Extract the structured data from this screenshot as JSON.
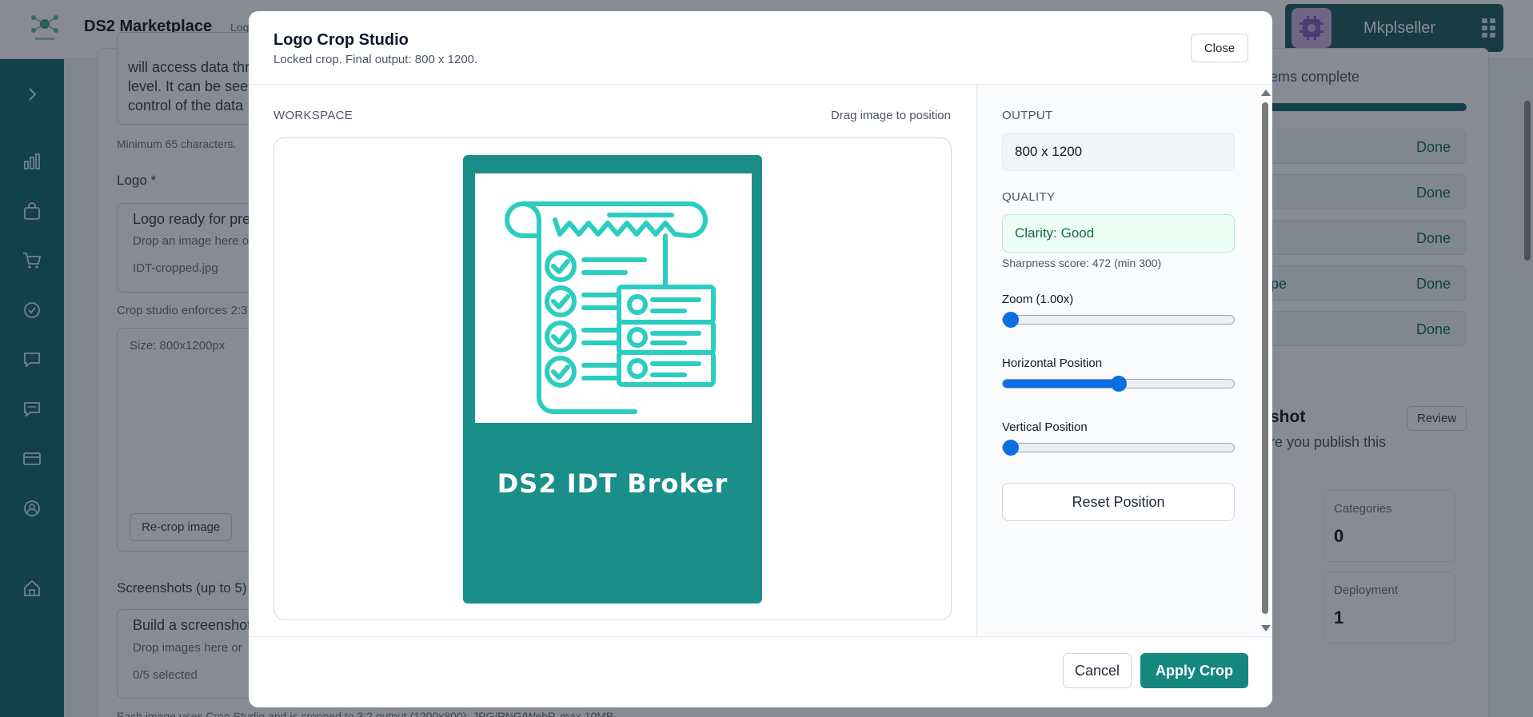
{
  "app": {
    "brand": "DS2 Marketplace",
    "brand_sub": "Log",
    "user_name": "Mkplseller"
  },
  "background": {
    "desc_line1": "will access data thr",
    "desc_line2": "level. It can be see",
    "desc_line3": "control of the data",
    "min_chars": "Minimum 65 characters.",
    "logo_label": "Logo *",
    "logo_ready": "Logo ready for pre",
    "logo_drop": "Drop an image here o",
    "logo_file": "IDT-cropped.jpg",
    "crop_note": "Crop studio enforces 2:3",
    "size_note": "Size: 800x1200px",
    "recrop_button": "Re-crop image",
    "screenshots_label": "Screenshots (up to 5)",
    "screenshot_build": "Build a screenshot",
    "screenshot_drop": "Drop images here or",
    "screenshot_selected": "0/5 selected",
    "footer_note": "Each image uses Crop Studio and is cropped to 3:2 output (1200x800). JPG/PNG/WebP, max 10MB.",
    "items_complete": "ems complete",
    "done_label": "Done",
    "done_row_4_prefix": "pe",
    "snapshot_title": "shot",
    "snapshot_sub": "re you publish this",
    "review_button": "Review",
    "stats": [
      {
        "label": "Categories",
        "value": "0"
      },
      {
        "label": "Deployment",
        "value": "1"
      }
    ]
  },
  "modal": {
    "title": "Logo Crop Studio",
    "subtitle": "Locked crop. Final output: 800 x 1200.",
    "close_label": "Close",
    "workspace_label": "WORKSPACE",
    "workspace_hint": "Drag image to position",
    "preview_text": "DS2 IDT Broker",
    "output_label": "OUTPUT",
    "output_value": "800 x 1200",
    "quality_label": "QUALITY",
    "quality_value": "Clarity: Good",
    "sharpness": "Sharpness score: 472 (min 300)",
    "zoom_label": "Zoom (1.00x)",
    "zoom_value": 0,
    "horizontal_label": "Horizontal Position",
    "horizontal_value": 0.5,
    "vertical_label": "Vertical Position",
    "vertical_value": 0,
    "reset_label": "Reset Position",
    "cancel_label": "Cancel",
    "apply_label": "Apply Crop"
  },
  "colors": {
    "accent": "#14877f",
    "sidebar": "#136a6c",
    "slider": "#0b6fe3",
    "preview_bg": "#1a8f89",
    "icon_teal": "#2ccdc1"
  },
  "icons": [
    "app-logo-icon",
    "apps-grid-icon",
    "chevron-right-icon",
    "chart-icon",
    "bag-icon",
    "cart-icon",
    "check-circle-icon",
    "chat-icon",
    "chat-alt-icon",
    "card-icon",
    "user-circle-icon",
    "home-icon",
    "receipt-checklist-icon"
  ]
}
